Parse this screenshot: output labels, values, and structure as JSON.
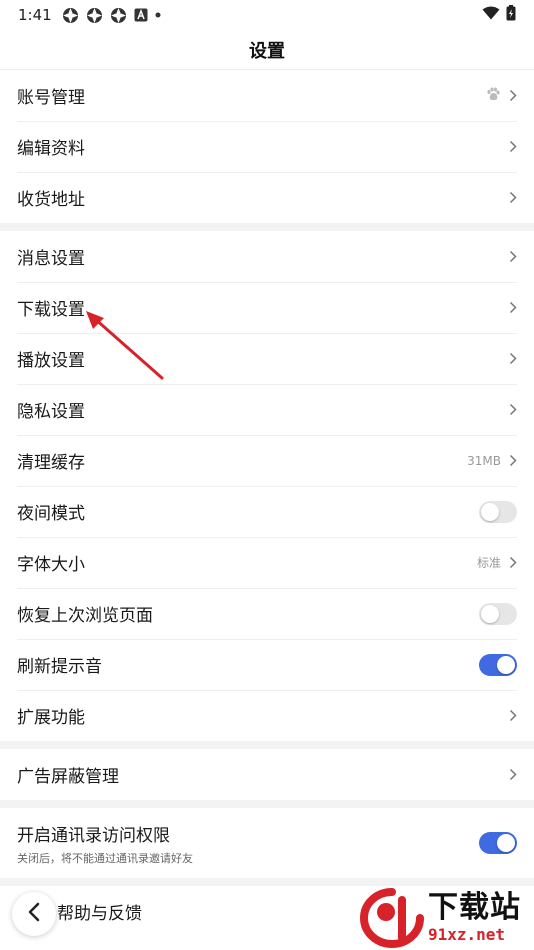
{
  "status_bar": {
    "time": "1:41"
  },
  "header": {
    "title": "设置"
  },
  "groups": [
    [
      {
        "key": "account",
        "label": "账号管理",
        "type": "nav",
        "icon": "paw-icon"
      },
      {
        "key": "profile",
        "label": "编辑资料",
        "type": "nav"
      },
      {
        "key": "address",
        "label": "收货地址",
        "type": "nav"
      }
    ],
    [
      {
        "key": "message",
        "label": "消息设置",
        "type": "nav"
      },
      {
        "key": "download",
        "label": "下载设置",
        "type": "nav"
      },
      {
        "key": "playback",
        "label": "播放设置",
        "type": "nav"
      },
      {
        "key": "privacy",
        "label": "隐私设置",
        "type": "nav"
      },
      {
        "key": "cache",
        "label": "清理缓存",
        "type": "nav",
        "value": "31MB"
      },
      {
        "key": "night",
        "label": "夜间模式",
        "type": "toggle",
        "on": false
      },
      {
        "key": "font",
        "label": "字体大小",
        "type": "nav",
        "value": "标准"
      },
      {
        "key": "restore",
        "label": "恢复上次浏览页面",
        "type": "toggle",
        "on": false
      },
      {
        "key": "refresh_sound",
        "label": "刷新提示音",
        "type": "toggle",
        "on": true
      },
      {
        "key": "extensions",
        "label": "扩展功能",
        "type": "nav"
      }
    ],
    [
      {
        "key": "adblock",
        "label": "广告屏蔽管理",
        "type": "nav"
      }
    ],
    [
      {
        "key": "contacts",
        "label": "开启通讯录访问权限",
        "sub": "关闭后，将不能通过通讯录邀请好友",
        "type": "toggle",
        "on": true
      }
    ],
    [
      {
        "key": "feedback",
        "label": "帮助与反馈",
        "type": "nav"
      }
    ]
  ],
  "watermark": {
    "title": "下载站",
    "url": "91xz.net"
  },
  "colors": {
    "toggle_on": "#3f6ae0",
    "toggle_off": "#e6e6e6",
    "arrow": "#d8222a",
    "divider": "#eeeeee",
    "section_gap": "#f3f3f3"
  }
}
